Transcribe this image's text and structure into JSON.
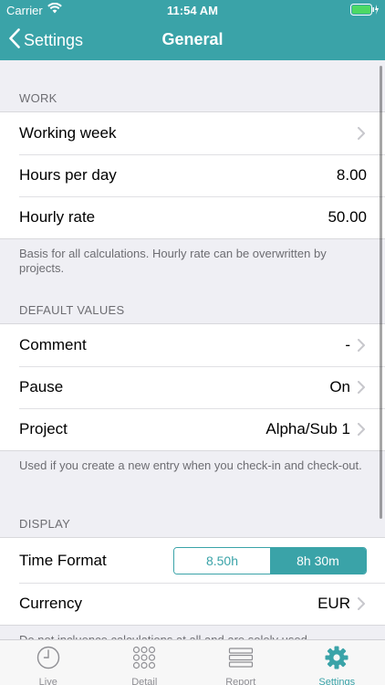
{
  "status_bar": {
    "carrier": "Carrier",
    "time": "11:54 AM"
  },
  "nav": {
    "back_label": "Settings",
    "title": "General"
  },
  "sections": {
    "work": {
      "header": "WORK",
      "rows": [
        {
          "label": "Working week",
          "value": ""
        },
        {
          "label": "Hours per day",
          "value": "8.00"
        },
        {
          "label": "Hourly rate",
          "value": "50.00"
        }
      ],
      "footer": "Basis for all calculations. Hourly rate can be overwritten by projects."
    },
    "defaults": {
      "header": "DEFAULT VALUES",
      "rows": [
        {
          "label": "Comment",
          "value": "-"
        },
        {
          "label": "Pause",
          "value": "On"
        },
        {
          "label": "Project",
          "value": "Alpha/Sub 1"
        }
      ],
      "footer": "Used if you create a new entry when you check-in and check-out."
    },
    "display": {
      "header": "DISPLAY",
      "time_format": {
        "label": "Time Format",
        "options": [
          "8.50h",
          "8h 30m"
        ],
        "selected": "8h 30m"
      },
      "currency": {
        "label": "Currency",
        "value": "EUR"
      },
      "footer": "Do not incluence calculations at all and are solely used"
    }
  },
  "tabs": [
    {
      "label": "Live",
      "icon": "clock-icon",
      "active": false
    },
    {
      "label": "Detail",
      "icon": "grid-icon",
      "active": false
    },
    {
      "label": "Report",
      "icon": "list-icon",
      "active": false
    },
    {
      "label": "Settings",
      "icon": "gear-icon",
      "active": true
    }
  ],
  "colors": {
    "accent": "#3aa3a8",
    "background": "#efeff4",
    "inactive_tab": "#8e8e93"
  }
}
